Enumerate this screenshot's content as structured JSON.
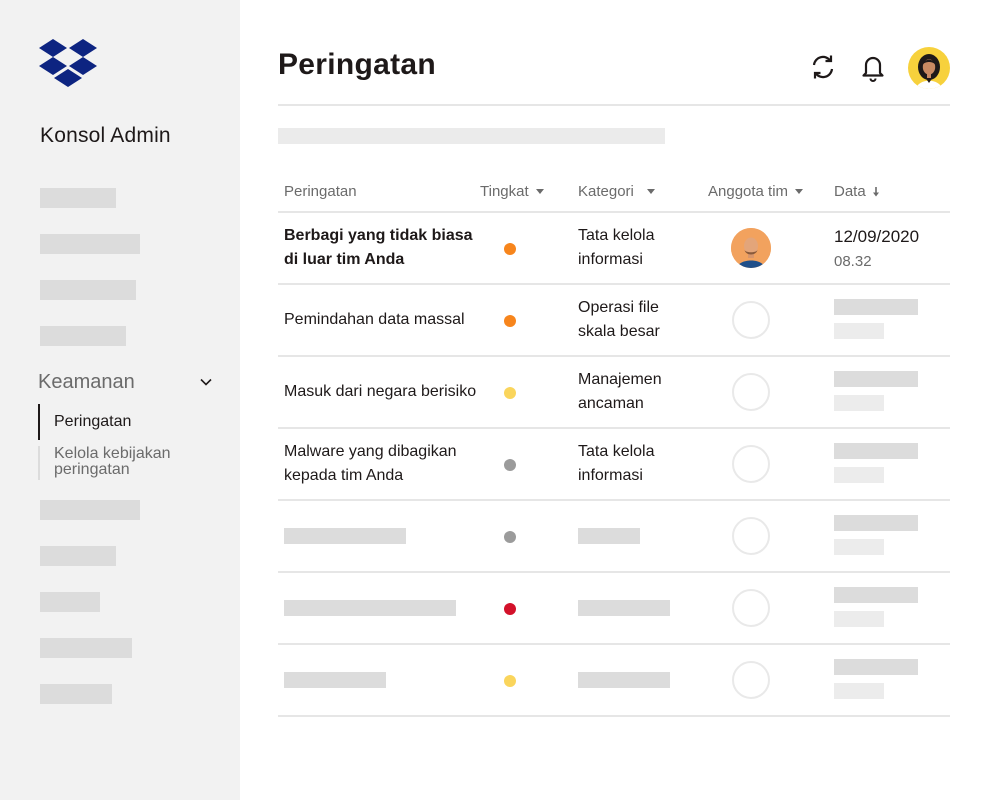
{
  "app": {
    "console_title": "Konsol Admin",
    "page_title": "Peringatan"
  },
  "sidebar": {
    "section": {
      "label": "Keamanan",
      "items": [
        {
          "label": "Peringatan",
          "active": true
        },
        {
          "label": "Kelola kebijakan peringatan",
          "active": false
        }
      ]
    }
  },
  "header": {
    "icons": [
      "refresh-icon",
      "bell-icon",
      "user-avatar"
    ]
  },
  "table": {
    "columns": [
      {
        "label": "Peringatan",
        "sort": "none"
      },
      {
        "label": "Tingkat",
        "sort": "caret"
      },
      {
        "label": "Kategori",
        "sort": "caret"
      },
      {
        "label": "Anggota tim",
        "sort": "caret"
      },
      {
        "label": "Data",
        "sort": "descending"
      }
    ],
    "rows": [
      {
        "name": "Berbagi yang tidak biasa di luar tim Anda",
        "bold": true,
        "level_color": "#f7851c",
        "category": "Tata kelola informasi",
        "member": "avatar",
        "date": "12/09/2020",
        "time": "08.32"
      },
      {
        "name": "Pemindahan data massal",
        "bold": false,
        "level_color": "#f7851c",
        "category": "Operasi file skala besar",
        "member": "empty"
      },
      {
        "name": "Masuk dari negara berisiko",
        "bold": false,
        "level_color": "#fad55c",
        "category": "Manajemen ancaman",
        "member": "empty"
      },
      {
        "name": "Malware yang dibagikan kepada tim Anda",
        "bold": false,
        "level_color": "#9b9b9b",
        "category": "Tata kelola informasi",
        "member": "empty"
      },
      {
        "level_color": "#9b9b9b",
        "member": "empty"
      },
      {
        "level_color": "#d3112a",
        "member": "empty"
      },
      {
        "level_color": "#fad55c",
        "member": "empty"
      }
    ]
  },
  "colors": {
    "brand": "#0d2481",
    "orange": "#f7851c",
    "yellow": "#fad55c",
    "gray": "#9b9b9b",
    "red": "#d3112a",
    "sidebar_bg": "#f2f2f2"
  }
}
